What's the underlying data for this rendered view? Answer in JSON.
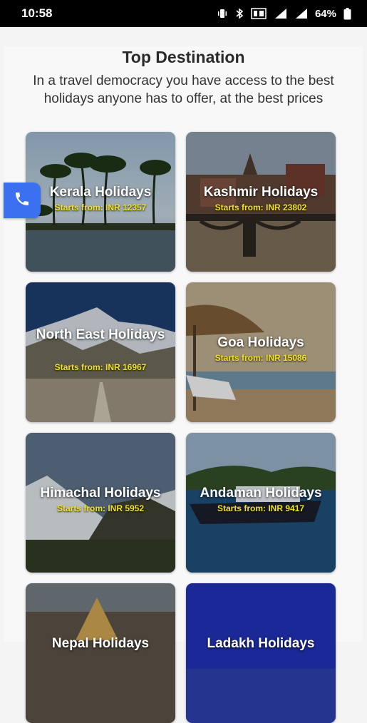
{
  "status_bar": {
    "time": "10:58",
    "battery_percent": "64%",
    "icons": [
      "vibrate-icon",
      "bluetooth-icon",
      "volte-icon",
      "4g-signal-icon",
      "signal-icon",
      "battery-icon"
    ]
  },
  "section": {
    "title": "Top Destination",
    "subtitle": "In a travel democracy you have access to the best holidays anyone has to offer, at the best prices"
  },
  "destinations": [
    {
      "name": "Kerala Holidays",
      "price": "Starts from: INR 12357"
    },
    {
      "name": "Kashmir Holidays",
      "price": "Starts from: INR 23802"
    },
    {
      "name": "North East Holidays",
      "price": "Starts from: INR 16967"
    },
    {
      "name": "Goa Holidays",
      "price": "Starts from: INR 15086"
    },
    {
      "name": "Himachal Holidays",
      "price": "Starts from: INR 5952"
    },
    {
      "name": "Andaman Holidays",
      "price": "Starts from: INR 9417"
    },
    {
      "name": "Nepal Holidays",
      "price": ""
    },
    {
      "name": "Ladakh Holidays",
      "price": ""
    }
  ],
  "colors": {
    "accent": "#3b70f0",
    "price_text": "#f5e51b",
    "status_bar": "#000000"
  },
  "floating_button": {
    "icon": "phone-icon"
  }
}
